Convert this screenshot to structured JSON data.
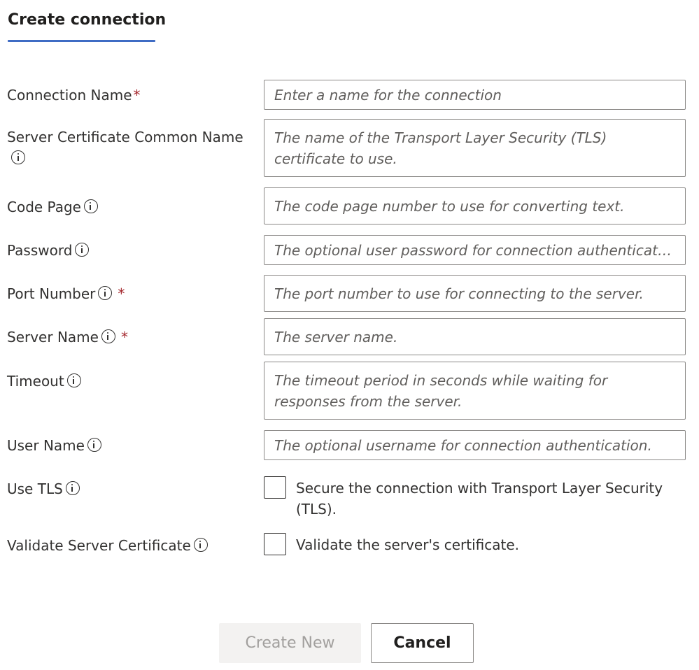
{
  "tab": {
    "label": "Create connection"
  },
  "form": {
    "connection_name": {
      "label": "Connection Name",
      "required": "*",
      "placeholder": "Enter a name for the connection"
    },
    "server_cert_common_name": {
      "label": "Server Certificate Common Name",
      "placeholder": "The name of the Transport Layer Security (TLS) certificate to use."
    },
    "code_page": {
      "label": "Code Page",
      "placeholder": "The code page number to use for converting text."
    },
    "password": {
      "label": "Password",
      "placeholder": "The optional user password for connection authenticatio..."
    },
    "port_number": {
      "label": "Port Number",
      "required": "*",
      "placeholder": "The port number to use for connecting to the server."
    },
    "server_name": {
      "label": "Server Name",
      "required": "*",
      "placeholder": "The server name."
    },
    "timeout": {
      "label": "Timeout",
      "placeholder": "The timeout period in seconds while waiting for responses from the server."
    },
    "user_name": {
      "label": "User Name",
      "placeholder": "The optional username for connection authentication."
    },
    "use_tls": {
      "label": "Use TLS",
      "checkbox_text": "Secure the connection with Transport Layer Security (TLS)."
    },
    "validate_server_cert": {
      "label": "Validate Server Certificate",
      "checkbox_text": "Validate the server's certificate."
    }
  },
  "buttons": {
    "create_new": "Create New",
    "cancel": "Cancel"
  },
  "colors": {
    "accent": "#3f6cc4",
    "required": "#a4262c",
    "disabled_bg": "#f3f2f1",
    "disabled_text": "#a19f9d"
  },
  "icons": {
    "info": "info-circle-icon"
  }
}
